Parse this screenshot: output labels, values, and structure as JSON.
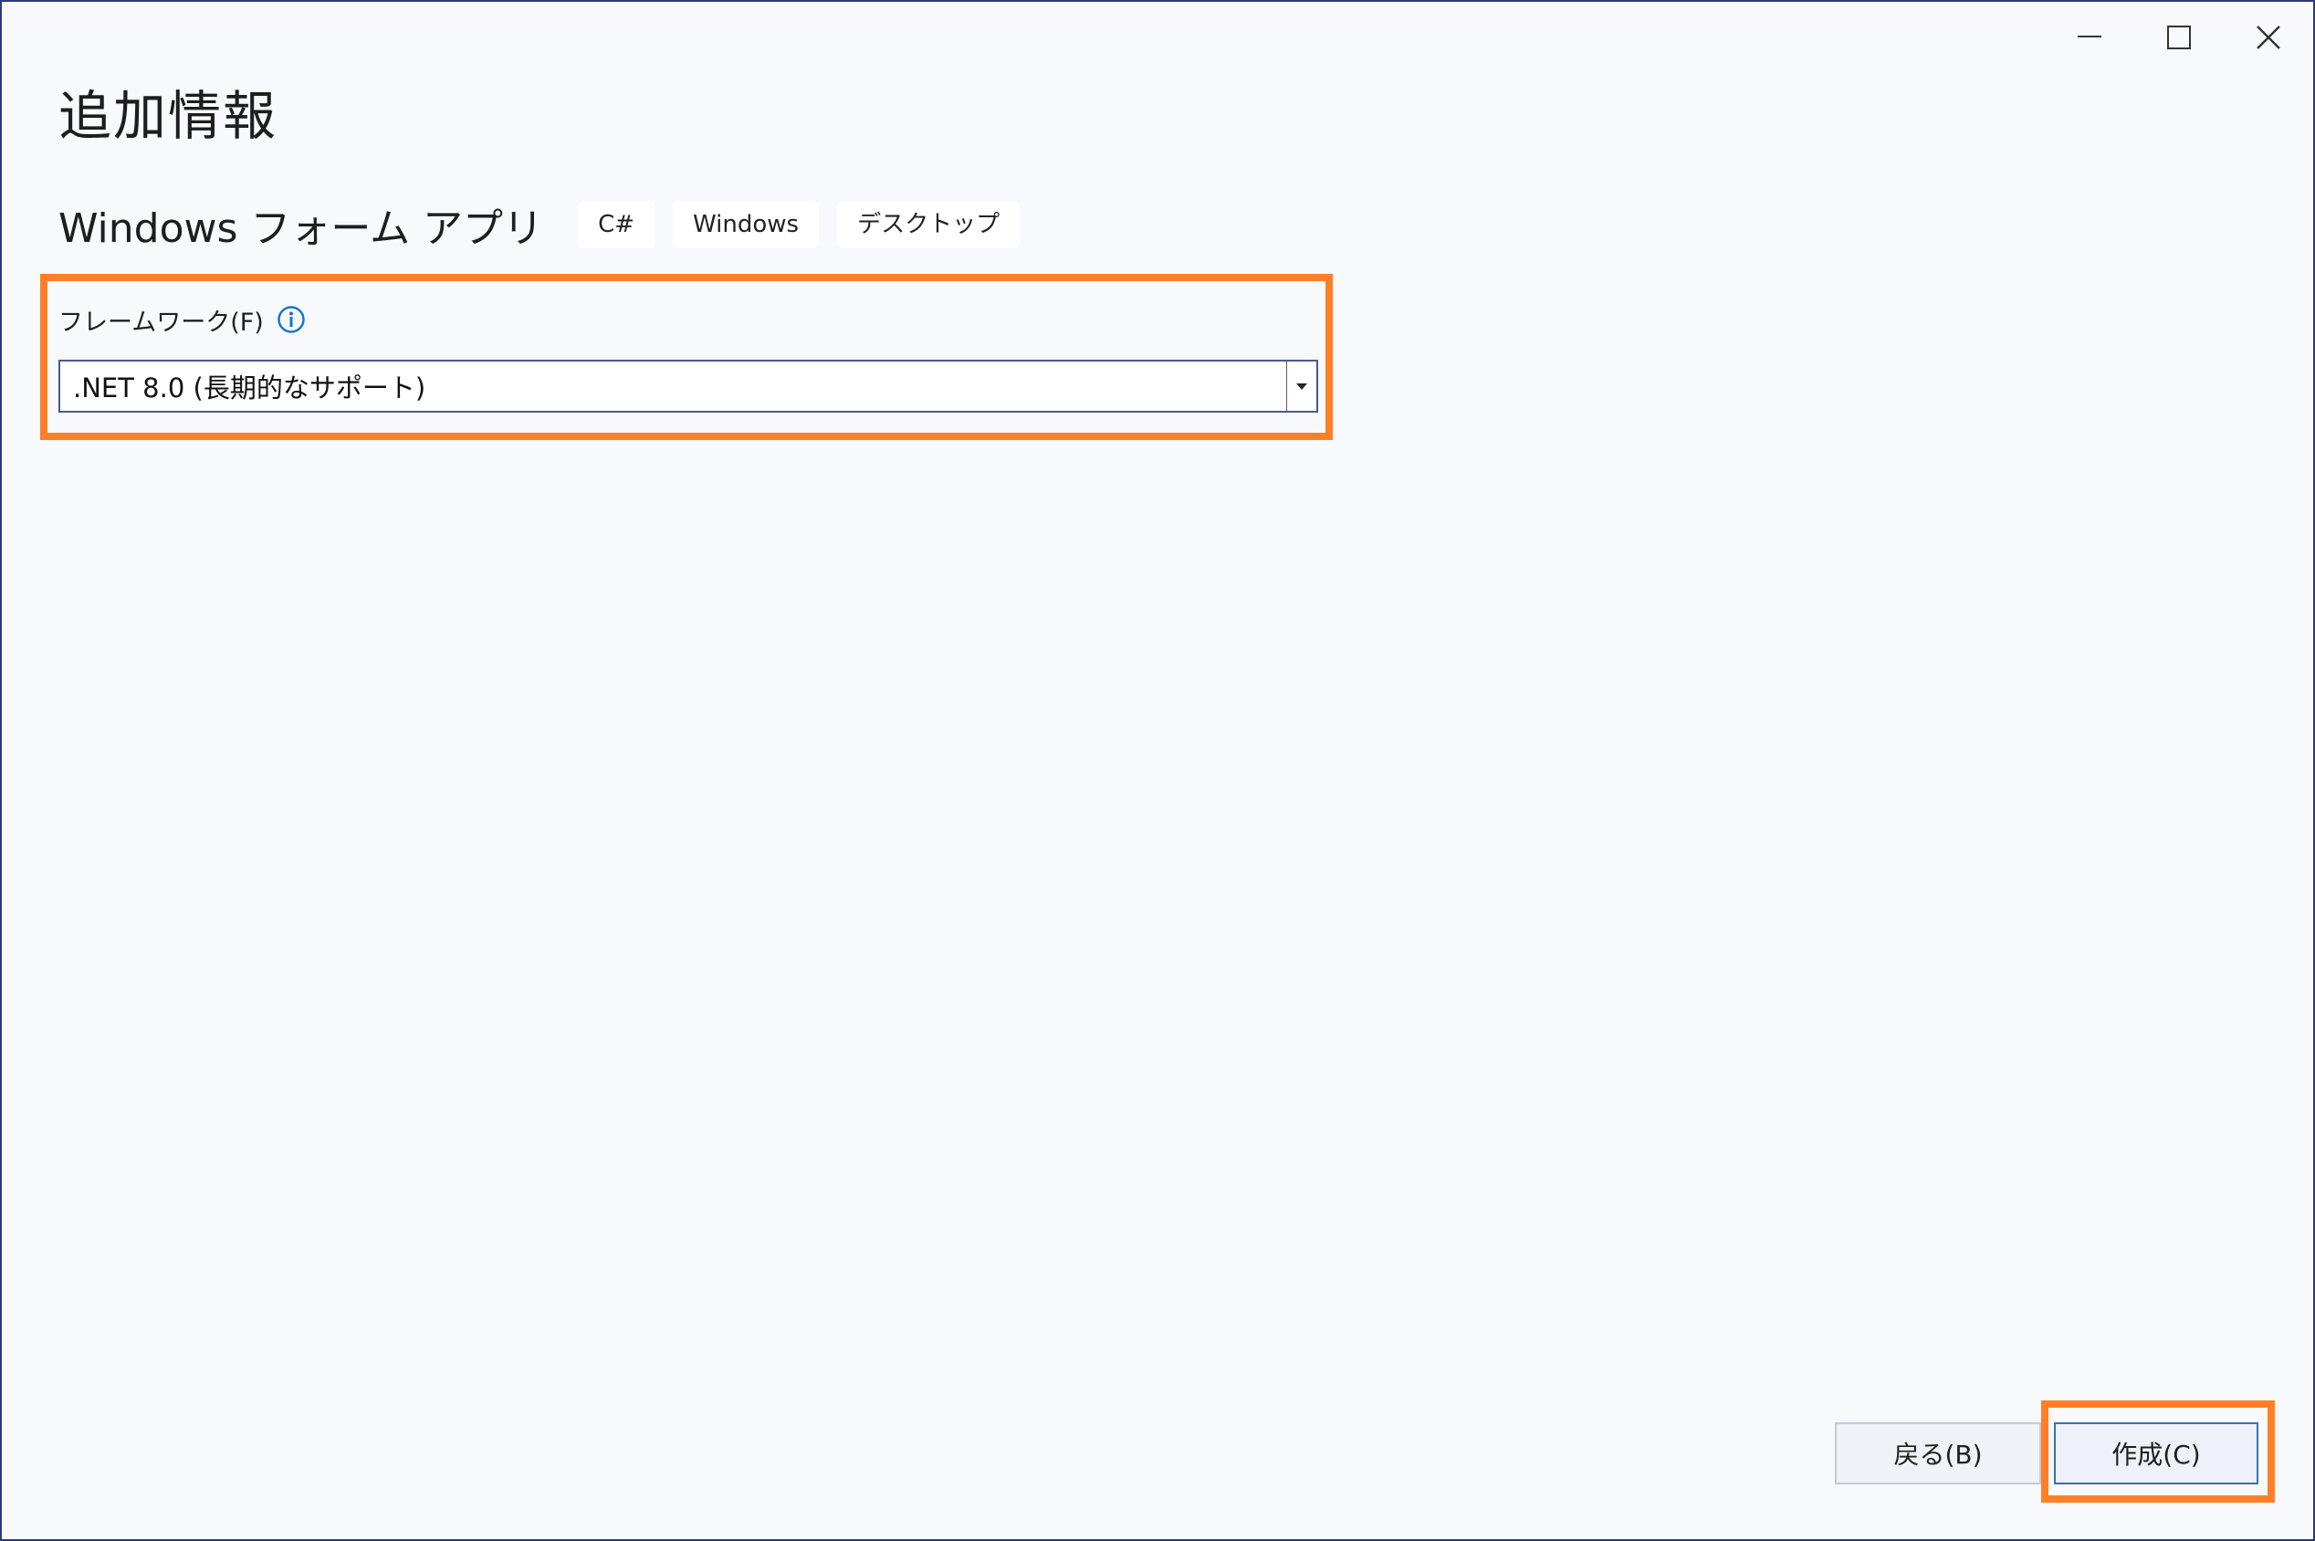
{
  "window": {
    "title": "追加情報",
    "controls": {
      "minimize_icon": "minimize-icon",
      "maximize_icon": "maximize-icon",
      "close_icon": "close-icon"
    }
  },
  "project": {
    "template_name": "Windows フォーム アプリ",
    "tags": [
      "C#",
      "Windows",
      "デスクトップ"
    ]
  },
  "framework": {
    "label": "フレームワーク(F)",
    "info_icon": "info-icon",
    "selected": ".NET 8.0 (長期的なサポート)"
  },
  "footer": {
    "back_label": "戻る(B)",
    "create_label": "作成(C)"
  },
  "colors": {
    "highlight": "#ff7f27",
    "accent": "#3b6fb5",
    "background": "#f8f9fc"
  }
}
